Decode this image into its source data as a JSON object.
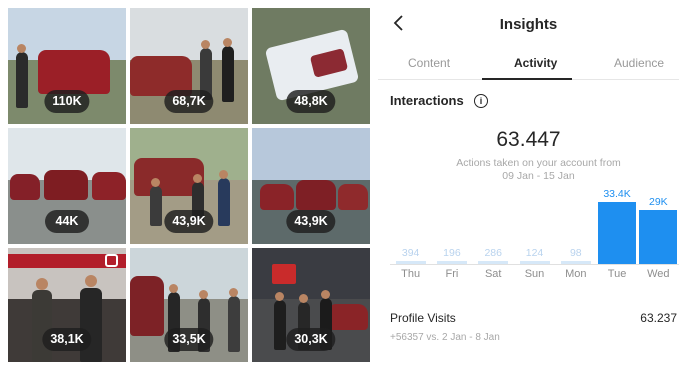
{
  "grid": {
    "tiles": [
      {
        "views": "110K"
      },
      {
        "views": "68,7K"
      },
      {
        "views": "48,8K"
      },
      {
        "views": "44K"
      },
      {
        "views": "43,9K"
      },
      {
        "views": "43,9K"
      },
      {
        "views": "38,1K"
      },
      {
        "views": "33,5K"
      },
      {
        "views": "30,3K"
      }
    ]
  },
  "insights": {
    "title": "Insights",
    "back_icon": "chevron-left-icon",
    "tabs": [
      {
        "label": "Content",
        "active": false
      },
      {
        "label": "Activity",
        "active": true
      },
      {
        "label": "Audience",
        "active": false
      }
    ],
    "section_title": "Interactions",
    "info_icon": "info-icon",
    "total": "63.447",
    "subtitle_line1": "Actions taken on your account from",
    "subtitle_line2": "09 Jan - 15 Jan",
    "profile_visits": {
      "label": "Profile Visits",
      "value": "63.237",
      "comparison": "+56357 vs. 2 Jan - 8 Jan"
    },
    "accent_color": "#1e8ff0"
  },
  "chart_data": {
    "type": "bar",
    "categories": [
      "Thu",
      "Fri",
      "Sat",
      "Sun",
      "Mon",
      "Tue",
      "Wed"
    ],
    "values": [
      394,
      196,
      286,
      124,
      98,
      33400,
      29000
    ],
    "labels": [
      "394",
      "196",
      "286",
      "124",
      "98",
      "33.4K",
      "29K"
    ]
  }
}
